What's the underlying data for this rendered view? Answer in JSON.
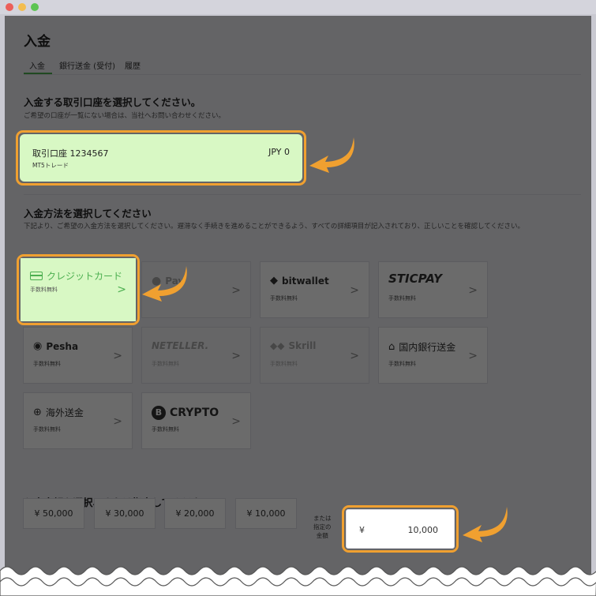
{
  "page": {
    "title": "入金",
    "tabs": [
      {
        "label": "入金"
      },
      {
        "label": "銀行送金 (受付)"
      },
      {
        "label": "履歴"
      }
    ]
  },
  "account_section": {
    "title": "入金する取引口座を選択してください。",
    "desc": "ご希望の口座が一覧にない場合は、当社へお問い合わせください。",
    "account": {
      "name": "取引口座 1234567",
      "type": "MT5トレード",
      "balance": "JPY 0"
    }
  },
  "method_section": {
    "title": "入金方法を選択してください",
    "desc": "下記より、ご希望の入金方法を選択してください。遅滞なく手続きを進めることができるよう、すべての詳細項目が記入されており、正しいことを確認してください。",
    "methods": [
      {
        "label": "クレジットカード",
        "fee": "手数料無料"
      },
      {
        "label": "Pay",
        "fee": ""
      },
      {
        "label": "bitwallet",
        "fee": "手数料無料"
      },
      {
        "label": "STICPAY",
        "fee": "手数料無料"
      },
      {
        "label": "Pesha",
        "fee": "手数料無料"
      },
      {
        "label": "NETELLER.",
        "fee": "手数料無料"
      },
      {
        "label": "Skrill",
        "fee": "手数料無料"
      },
      {
        "label": "国内銀行送金",
        "fee": "手数料無料"
      },
      {
        "label": "海外送金",
        "fee": "手数料無料"
      },
      {
        "label": "CRYPTO",
        "fee": "手数料無料"
      }
    ]
  },
  "amount_section": {
    "title": "入金金額を選択、または指定してください。",
    "presets": [
      "¥ 50,000",
      "¥ 30,000",
      "¥ 20,000",
      "¥ 10,000"
    ],
    "or_label": "または指定の金額",
    "or_line1": "または",
    "or_line2": "指定の",
    "or_line3": "金額",
    "currency_symbol": "¥",
    "amount_value": "10,000"
  },
  "colors": {
    "highlight_green": "#d8f8c4",
    "accent_orange": "#f0a030",
    "tab_active": "#4caf50"
  }
}
